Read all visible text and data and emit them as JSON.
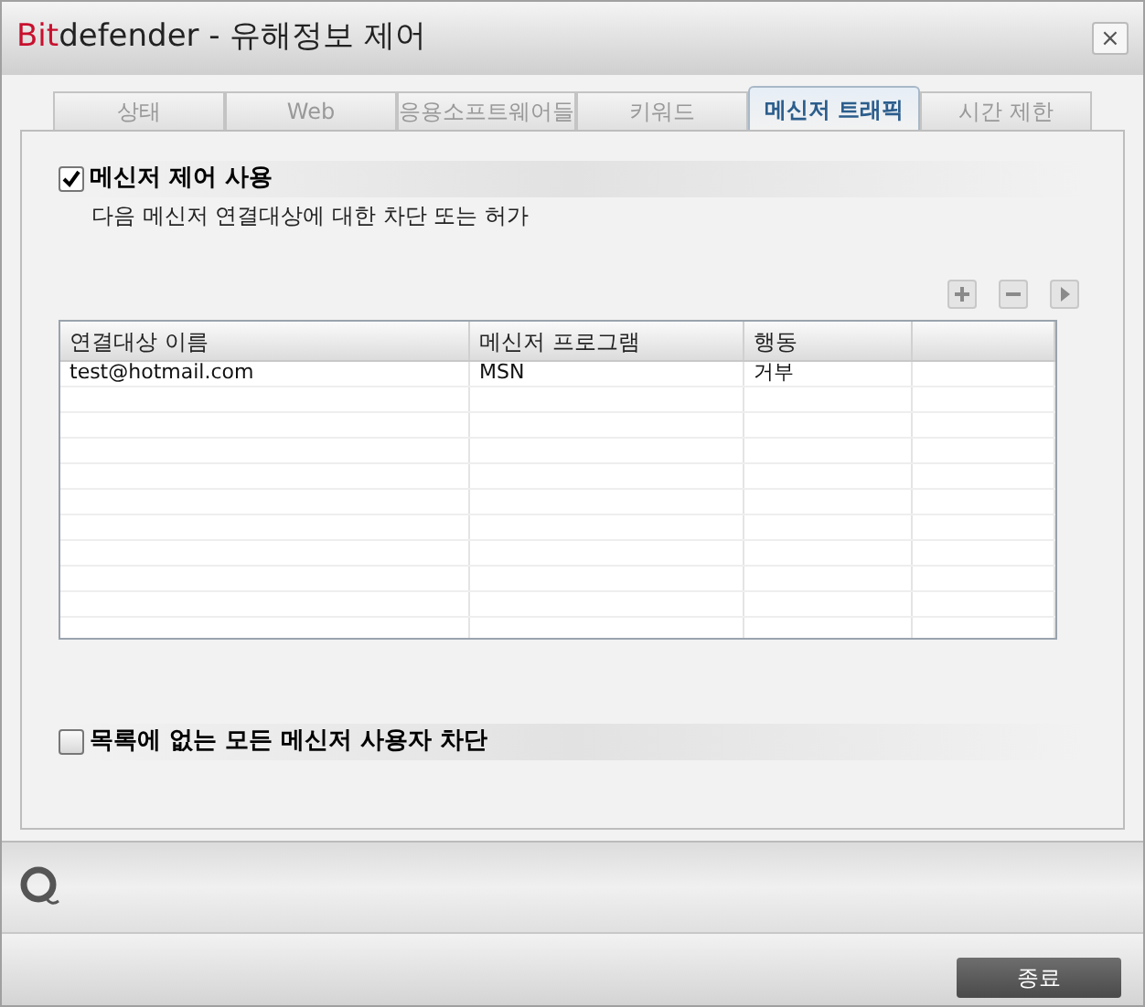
{
  "window": {
    "title_brand": "Bit",
    "title": "defender - 유해정보 제어",
    "close": "×"
  },
  "tabs": [
    {
      "label": "상태",
      "selected": false
    },
    {
      "label": "Web",
      "selected": false
    },
    {
      "label": "응용소프트웨어들",
      "selected": false
    },
    {
      "label": "키워드",
      "selected": false
    },
    {
      "label": "메신저 트래픽",
      "selected": true
    },
    {
      "label": "시간 제한",
      "selected": false
    }
  ],
  "enable_control": {
    "label": "메신저 제어 사용",
    "checked": true
  },
  "description": "다음 메신저 연결대상에 대한 차단 또는 허가",
  "table": {
    "columns": [
      "연결대상 이름",
      "메신저 프로그램",
      "행동"
    ],
    "rows": [
      [
        "test@hotmail.com",
        "MSN",
        "거부"
      ]
    ]
  },
  "block_unlisted": {
    "label": "목록에 없는 모든 메신저 사용자 차단",
    "checked": false
  },
  "close_button": "종료"
}
